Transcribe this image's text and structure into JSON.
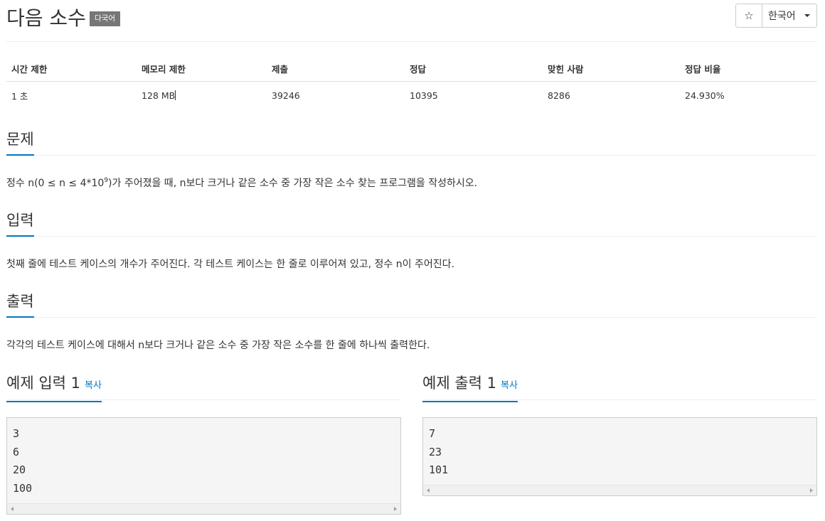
{
  "header": {
    "title": "다음 소수",
    "badge": "다국어",
    "star_icon": "☆",
    "language": "한국어"
  },
  "info": {
    "headers": [
      "시간 제한",
      "메모리 제한",
      "제출",
      "정답",
      "맞힌 사람",
      "정답 비율"
    ],
    "values": [
      "1 초",
      "128 MB",
      "39246",
      "10395",
      "8286",
      "24.930%"
    ]
  },
  "problem": {
    "title": "문제",
    "text_before": "정수 n(0 ≤ n ≤ 4*10",
    "text_sup": "9",
    "text_after": ")가 주어졌을 때, n보다 크거나 같은 소수 중 가장 작은 소수 찾는 프로그램을 작성하시오."
  },
  "input": {
    "title": "입력",
    "text": "첫째 줄에 테스트 케이스의 개수가 주어진다. 각 테스트 케이스는 한 줄로 이루어져 있고, 정수 n이 주어진다."
  },
  "output": {
    "title": "출력",
    "text": "각각의 테스트 케이스에 대해서 n보다 크거나 같은 소수 중 가장 작은 소수를 한 줄에 하나씩 출력한다."
  },
  "sample_input": {
    "title": "예제 입력 1",
    "copy": "복사",
    "lines": [
      "3",
      "6",
      "20",
      "100"
    ]
  },
  "sample_output": {
    "title": "예제 출력 1",
    "copy": "복사",
    "lines": [
      "7",
      "23",
      "101"
    ]
  }
}
